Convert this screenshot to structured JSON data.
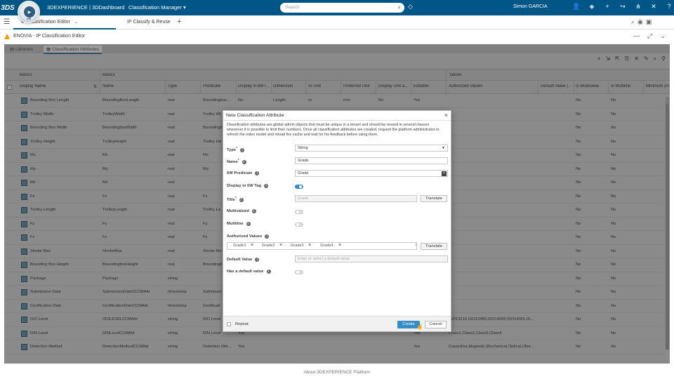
{
  "topbar": {
    "brand": "3DEXPERIENCE | 3DDashboard",
    "app_title": "Classification Manager",
    "compass_version": "V.R",
    "search_placeholder": "Search",
    "user": "Simon GARCIA"
  },
  "tabs": [
    {
      "label": "IP Classification Editor",
      "active": true
    },
    {
      "label": "IP Classify & Reuse",
      "active": false
    }
  ],
  "widget": {
    "title": "ENOVIA - IP Classification Editor"
  },
  "subtabs": [
    {
      "label": "Libraries",
      "active": false
    },
    {
      "label": "Classification Attributes",
      "active": true
    }
  ],
  "grid": {
    "group_headers": [
      "Basics",
      "Basics",
      "Values"
    ],
    "columns": [
      "Display Name",
      "Name",
      "Type",
      "Predicate",
      "Display in 6WT...",
      "Dimension",
      "SI Unit",
      "Preferred Unit",
      "Display Unit a...",
      "Editable",
      "Authorized Values",
      "Default Value (...",
      "Is Multivalue",
      "Is Multiline",
      "Minimum (in..."
    ],
    "rows": [
      {
        "display": "Bounding Box Length",
        "name": "BoundingBoxLength",
        "type": "real",
        "predicate": "Boundingbox...",
        "d6wt": "No",
        "dim": "Length",
        "si": "m",
        "pref": "mm",
        "dua": "No",
        "edit": "Yes",
        "auth": "",
        "mv": "No",
        "ml": "No"
      },
      {
        "display": "Trolley Width",
        "name": "TrolleyWidth",
        "type": "real",
        "predicate": "Trolley Wi",
        "d6wt": "",
        "dim": "",
        "si": "",
        "pref": "",
        "dua": "",
        "edit": "",
        "auth": "",
        "mv": "No",
        "ml": "No"
      },
      {
        "display": "Bounding Box Width",
        "name": "BoundingboxWidth",
        "type": "real",
        "predicate": "Boundingb",
        "d6wt": "",
        "dim": "",
        "si": "",
        "pref": "",
        "dua": "",
        "edit": "",
        "auth": "",
        "mv": "No",
        "ml": "No"
      },
      {
        "display": "Trolley Height",
        "name": "TrolleyHeight",
        "type": "real",
        "predicate": "Trolley He",
        "d6wt": "",
        "dim": "",
        "si": "",
        "pref": "",
        "dua": "",
        "edit": "",
        "auth": "",
        "mv": "No",
        "ml": "No"
      },
      {
        "display": "Mx",
        "name": "Mx",
        "type": "real",
        "predicate": "Mx",
        "d6wt": "",
        "dim": "",
        "si": "",
        "pref": "",
        "dua": "",
        "edit": "",
        "auth": "",
        "mv": "No",
        "ml": "No"
      },
      {
        "display": "My",
        "name": "My",
        "type": "real",
        "predicate": "My",
        "d6wt": "",
        "dim": "",
        "si": "",
        "pref": "",
        "dua": "",
        "edit": "",
        "auth": "",
        "mv": "No",
        "ml": "No"
      },
      {
        "display": "Mz",
        "name": "Mz",
        "type": "real",
        "predicate": "",
        "d6wt": "",
        "dim": "",
        "si": "",
        "pref": "",
        "dua": "",
        "edit": "",
        "auth": "",
        "mv": "No",
        "ml": "No"
      },
      {
        "display": "Fx",
        "name": "Fx",
        "type": "real",
        "predicate": "Fx",
        "d6wt": "",
        "dim": "",
        "si": "",
        "pref": "",
        "dua": "",
        "edit": "",
        "auth": "",
        "mv": "No",
        "ml": "No"
      },
      {
        "display": "Trolley Length",
        "name": "TrolleyLength",
        "type": "real",
        "predicate": "Trolley Le",
        "d6wt": "",
        "dim": "",
        "si": "",
        "pref": "",
        "dua": "",
        "edit": "",
        "auth": "",
        "mv": "No",
        "ml": "No"
      },
      {
        "display": "Fy",
        "name": "Fy",
        "type": "real",
        "predicate": "Fy",
        "d6wt": "",
        "dim": "",
        "si": "",
        "pref": "",
        "dua": "",
        "edit": "",
        "auth": "",
        "mv": "No",
        "ml": "No"
      },
      {
        "display": "Fz",
        "name": "Fz",
        "type": "real",
        "predicate": "Fz",
        "d6wt": "",
        "dim": "",
        "si": "",
        "pref": "",
        "dua": "",
        "edit": "",
        "auth": "",
        "mv": "No",
        "ml": "No"
      },
      {
        "display": "Stroke Max",
        "name": "StrokeMax",
        "type": "real",
        "predicate": "Stroke Ma",
        "d6wt": "",
        "dim": "",
        "si": "",
        "pref": "",
        "dua": "",
        "edit": "",
        "auth": "",
        "mv": "No",
        "ml": "No"
      },
      {
        "display": "Bounding Box Height",
        "name": "BoundingboxHeight",
        "type": "real",
        "predicate": "Boundingb",
        "d6wt": "",
        "dim": "",
        "si": "",
        "pref": "",
        "dua": "",
        "edit": "",
        "auth": "",
        "mv": "No",
        "ml": "No"
      },
      {
        "display": "Package",
        "name": "Package",
        "type": "string",
        "predicate": "",
        "d6wt": "",
        "dim": "",
        "si": "",
        "pref": "",
        "dua": "",
        "edit": "",
        "auth": "",
        "mv": "No",
        "ml": "No"
      },
      {
        "display": "Submission Date",
        "name": "SubmissionDate2CCMAttr",
        "type": "timestamp",
        "predicate": "Submissio",
        "d6wt": "",
        "dim": "",
        "si": "",
        "pref": "",
        "dua": "",
        "edit": "",
        "auth": "",
        "mv": "No",
        "ml": "No"
      },
      {
        "display": "Certification Date",
        "name": "CertificationDateCCMAttr",
        "type": "timestamp",
        "predicate": "Certificati",
        "d6wt": "",
        "dim": "",
        "si": "",
        "pref": "",
        "dua": "",
        "edit": "",
        "auth": "",
        "mv": "No",
        "ml": "No"
      },
      {
        "display": "ISO Level",
        "name": "ISOLEVELCCMAttr",
        "type": "string",
        "predicate": "ISO Level",
        "d6wt": "",
        "dim": "",
        "si": "",
        "pref": "",
        "dua": "",
        "edit": "",
        "auth": "ISO13216,ISO13485,ISO14000,ISO14001,IS...",
        "mv": "No",
        "ml": "No"
      },
      {
        "display": "DIN Level",
        "name": "DINLevelCCMAttr",
        "type": "string",
        "predicate": "DIN Level",
        "d6wt": "Yes",
        "dim": "",
        "si": "",
        "pref": "",
        "dua": "",
        "edit": "Yes",
        "auth": "Class1,Class2,Class3,Class4",
        "mv": "No",
        "ml": "No"
      },
      {
        "display": "Detection Method",
        "name": "DetectionMethodCCMAttr",
        "type": "string",
        "predicate": "Detection Met...",
        "d6wt": "Yes",
        "dim": "",
        "si": "",
        "pref": "",
        "dua": "",
        "edit": "Yes",
        "auth": "Capacitive,Magnetic,Mechanical,Optical,Ultra...",
        "mv": "No",
        "ml": "No"
      }
    ]
  },
  "modal": {
    "title": "New Classification Attribute",
    "description": "Classification attributes are global admin objects that must be unique in a tenant and should be reused in several classes whenever it is possible to limit their numbers. Once all classification attributes are created, request the platform administrator to refresh the index model and reload the cache and wait for his feedback before using them.",
    "type_label": "Type",
    "type_value": "String",
    "name_label": "Name",
    "name_value": "Grade",
    "predicate_label": "6W Predicate",
    "predicate_value": "Grade",
    "display6w_label": "Display in 6W Tag",
    "display6w_on": true,
    "title_label": "Title",
    "title_placeholder": "Grade",
    "translate_label": "Translate",
    "multivalued_label": "Multivalued",
    "multiline_label": "Multiline",
    "authorized_label": "Authorized Values",
    "authorized_values": [
      "Grade1",
      "Grade2",
      "Grade3",
      "Grade4"
    ],
    "default_label": "Default Value",
    "default_placeholder": "Enter or select a default value",
    "has_default_label": "Has a default value",
    "repeat_label": "Repeat",
    "create_label": "Create",
    "cancel_label": "Cancel",
    "required_mark": "*",
    "info_mark": "i"
  },
  "footer": {
    "text": "About 3DEXPERIENCE Platform"
  }
}
